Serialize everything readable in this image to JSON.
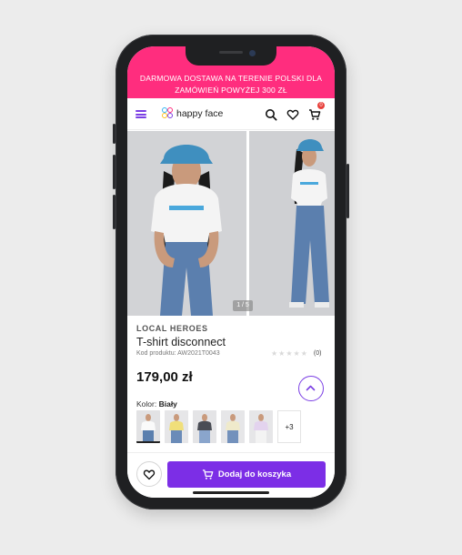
{
  "promo": {
    "line1": "DARMOWA DOSTAWA NA TERENIE POLSKI DLA",
    "line2": "ZAMÓWIEŃ POWYŻEJ 300 ZŁ"
  },
  "header": {
    "logo_text": "happy face",
    "cart_count": "0",
    "icons": [
      "menu-icon",
      "search-icon",
      "heart-icon",
      "cart-icon"
    ]
  },
  "gallery": {
    "counter": "1 / 5"
  },
  "product": {
    "brand": "LOCAL HEROES",
    "name": "T-shirt disconnect",
    "code": "Kod produktu: AW2021T0043",
    "rating_count": "(0)",
    "rating_value": 0,
    "price": "179,00 zł",
    "color_label": "Kolor:",
    "color_value": "Biały",
    "more_colors": "+3"
  },
  "actions": {
    "add_to_cart": "Dodaj do koszyka"
  },
  "colors": {
    "promo_bg": "#ff2d7e",
    "accent": "#7c2ee6"
  }
}
